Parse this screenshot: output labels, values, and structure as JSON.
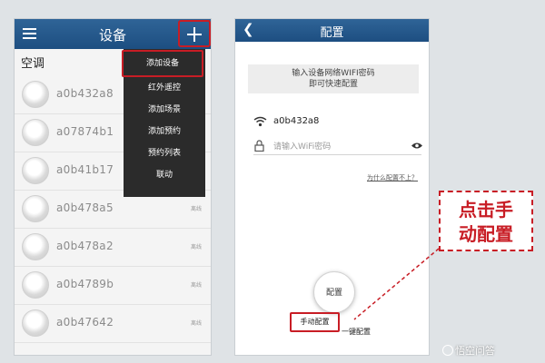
{
  "left_screen": {
    "header": {
      "title": "设备"
    },
    "section_label": "空调",
    "devices": [
      {
        "name": "a0b432a8",
        "status": ""
      },
      {
        "name": "a07874b1",
        "status": ""
      },
      {
        "name": "a0b41b17",
        "status": ""
      },
      {
        "name": "a0b478a5",
        "status": "离线"
      },
      {
        "name": "a0b478a2",
        "status": "离线"
      },
      {
        "name": "a0b4789b",
        "status": "离线"
      },
      {
        "name": "a0b47642",
        "status": "离线"
      }
    ],
    "dropdown_menu": [
      "添加设备",
      "红外遥控",
      "添加场景",
      "添加预约",
      "预约列表",
      "联动"
    ]
  },
  "right_screen": {
    "header": {
      "title": "配置"
    },
    "hint_line1": "输入设备网络WIFI密码",
    "hint_line2": "即可快速配置",
    "ssid": "a0b432a8",
    "password_placeholder": "请输入WiFi密码",
    "why_link": "为什么配置不上？",
    "config_button": "配置",
    "manual_config": "手动配置",
    "one_key_config": "一键配置"
  },
  "annotation": {
    "line1": "点击手",
    "line2": "动配置"
  },
  "watermark": "悟空问答",
  "colors": {
    "header_blue": "#2f6497",
    "highlight_red": "#c81d25",
    "menu_dark": "#2b2b2b"
  }
}
